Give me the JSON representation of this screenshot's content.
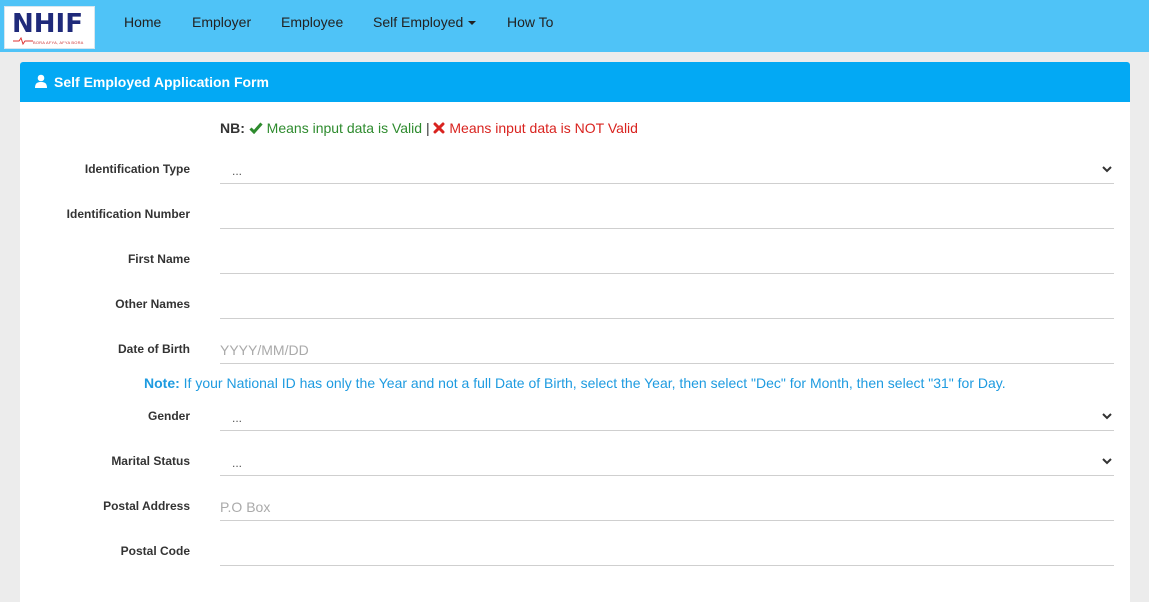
{
  "brand": {
    "logo_text": "NHIF",
    "logo_tagline": "BORA AFYA, AFYA BORA"
  },
  "nav": {
    "items": [
      "Home",
      "Employer",
      "Employee",
      "Self Employed",
      "How To"
    ]
  },
  "panel": {
    "title": "Self Employed Application Form"
  },
  "nb": {
    "label": "NB:",
    "valid_text": "Means input data is Valid",
    "separator": "|",
    "invalid_text": "Means input data is NOT Valid"
  },
  "form": {
    "identification_type": {
      "label": "Identification Type",
      "value": "..."
    },
    "identification_number": {
      "label": "Identification Number",
      "value": ""
    },
    "first_name": {
      "label": "First Name",
      "value": ""
    },
    "other_names": {
      "label": "Other Names",
      "value": ""
    },
    "date_of_birth": {
      "label": "Date of Birth",
      "placeholder": "YYYY/MM/DD"
    },
    "note": {
      "label": "Note:",
      "text": "If your National ID has only the Year and not a full Date of Birth, select the Year, then select \"Dec\" for Month, then select \"31\" for Day."
    },
    "gender": {
      "label": "Gender",
      "value": "..."
    },
    "marital_status": {
      "label": "Marital Status",
      "value": "..."
    },
    "postal_address": {
      "label": "Postal Address",
      "placeholder": "P.O Box"
    },
    "postal_code": {
      "label": "Postal Code",
      "value": ""
    }
  },
  "colors": {
    "navbar": "#4fc3f7",
    "panel_heading": "#03a9f4",
    "valid": "#2e8b2e",
    "invalid": "#d9231f",
    "note": "#1e9be0"
  }
}
